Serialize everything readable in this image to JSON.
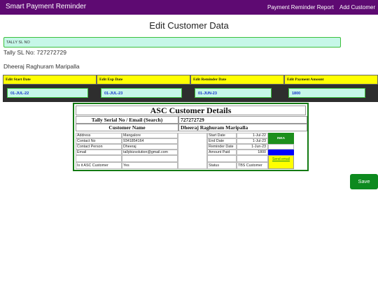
{
  "navbar": {
    "brand": "Smart Payment Reminder",
    "links": [
      "Payment Reminder Report",
      "Add Customer"
    ]
  },
  "page_title": "Edit Customer Data",
  "search": {
    "placeholder": "TALLY SL NO"
  },
  "tally_sl_line": "Tally SL No: 727272729",
  "customer_name_line": "Dheeraj Raghuram Maripalla",
  "edit_fields": [
    {
      "label": "Edit Start Date",
      "value": "01-JUL-22"
    },
    {
      "label": "Edit Exp Date",
      "value": "01-JUL-23"
    },
    {
      "label": "Edit Reminder Date",
      "value": "01-JUN-23"
    },
    {
      "label": "Edit Payment Amount",
      "value": "1800"
    }
  ],
  "report": {
    "title": "ASC Customer Details",
    "serial_label": "Tally Serial No / Email (Search)",
    "serial_value": "727272729",
    "name_label": "Customer Name",
    "name_value": "Dheeraj Raghuram Maripalla",
    "left_rows": [
      {
        "label": "Address",
        "value": "Mangalore"
      },
      {
        "label": "Contact No",
        "value": "9341854164"
      },
      {
        "label": "Contact Person",
        "value": "Dheeraj"
      },
      {
        "label": "Email",
        "value": "tallybizsolution@gmail.com"
      },
      {
        "label": "",
        "value": ""
      },
      {
        "label": "Is it ASC Customer",
        "value": "Yes"
      }
    ],
    "right_rows": [
      {
        "label": "Start Date",
        "value": "1-Jul-22"
      },
      {
        "label": "End Date",
        "value": "1-Jul-23"
      },
      {
        "label": "Reminder Date",
        "value": "1-Jun-23"
      },
      {
        "label": "Amount Paid",
        "value": "1800"
      },
      {
        "label": "",
        "value": ""
      },
      {
        "label": "Status",
        "value": "TBS Customer"
      }
    ],
    "badge": "INKA",
    "send_email": "Send email"
  },
  "save_label": "Save",
  "colors": {
    "navbar": "#5e0a72",
    "accent_yellow": "#ffff00",
    "input_bg": "#c6f7e8",
    "save": "#0d8a1f"
  }
}
